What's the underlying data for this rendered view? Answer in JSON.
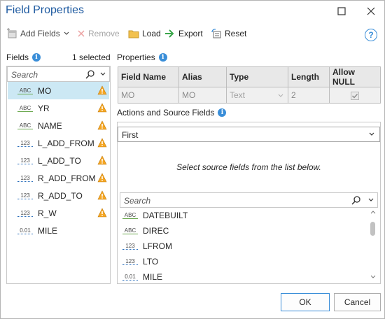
{
  "window": {
    "title": "Field Properties"
  },
  "toolbar": {
    "add_fields_label": "Add Fields",
    "remove_label": "Remove",
    "load_label": "Load",
    "export_label": "Export",
    "reset_label": "Reset"
  },
  "fields_panel": {
    "label": "Fields",
    "selected_count": "1 selected",
    "search_placeholder": "Search",
    "items": [
      {
        "type": "ABC",
        "name": "MO",
        "warning": true,
        "selected": true
      },
      {
        "type": "ABC",
        "name": "YR",
        "warning": true,
        "selected": false
      },
      {
        "type": "ABC",
        "name": "NAME",
        "warning": true,
        "selected": false
      },
      {
        "type": "123",
        "name": "L_ADD_FROM",
        "warning": true,
        "selected": false
      },
      {
        "type": "123",
        "name": "L_ADD_TO",
        "warning": true,
        "selected": false
      },
      {
        "type": "123",
        "name": "R_ADD_FROM",
        "warning": true,
        "selected": false
      },
      {
        "type": "123",
        "name": "R_ADD_TO",
        "warning": true,
        "selected": false
      },
      {
        "type": "123",
        "name": "R_W",
        "warning": true,
        "selected": false
      },
      {
        "type": "0.01",
        "name": "MILE",
        "warning": false,
        "selected": false
      }
    ]
  },
  "properties": {
    "label": "Properties",
    "headers": [
      "Field Name",
      "Alias",
      "Type",
      "Length",
      "Allow NULL"
    ],
    "row": {
      "field_name": "MO",
      "alias": "MO",
      "type": "Text",
      "length": "2",
      "allow_null": true
    }
  },
  "actions": {
    "label": "Actions and Source Fields",
    "selected_action": "First",
    "hint": "Select source fields from the list below.",
    "search_placeholder": "Search",
    "source_fields": [
      {
        "type": "ABC",
        "name": "DATEBUILT"
      },
      {
        "type": "ABC",
        "name": "DIREC"
      },
      {
        "type": "123",
        "name": "LFROM"
      },
      {
        "type": "123",
        "name": "LTO"
      },
      {
        "type": "0.01",
        "name": "MILE"
      }
    ]
  },
  "buttons": {
    "ok": "OK",
    "cancel": "Cancel"
  },
  "colors": {
    "accent": "#3a8ed8",
    "title": "#1e5aa0",
    "selection": "#cce8f4",
    "warning": "#f5a623"
  }
}
